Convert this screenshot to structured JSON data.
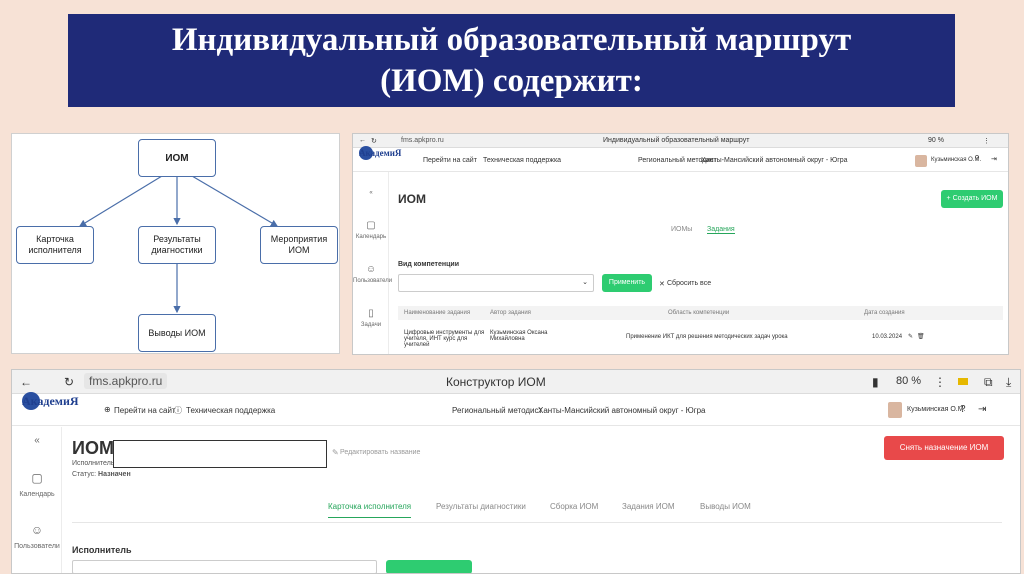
{
  "title": "Индивидуальный образовательный маршрут (ИОМ) содержит:",
  "diagram": {
    "root": "ИОМ",
    "nodes": [
      "Карточка исполнителя",
      "Результаты диагностики",
      "Мероприятия ИОМ"
    ],
    "bottom": "Выводы ИОМ"
  },
  "shot1": {
    "url": "fms.apkpro.ru",
    "window_title": "Индивидуальный образовательный маршрут",
    "zoom": "90 %",
    "logo": "АкадемиЯ",
    "go_site": "Перейти на сайт",
    "support": "Техническая поддержка",
    "role": "Региональный методист",
    "region": "Ханты-Мансийский автономный округ - Югра",
    "user": "Кузьминская О.М.",
    "heading": "ИОМ",
    "create_btn": "+ Создать ИОМ",
    "tabs": [
      "ИОМы",
      "Задания"
    ],
    "filter_label": "Вид компетенции",
    "apply_btn": "Применить",
    "reset": "Сбросить все",
    "columns": [
      "Наименование задания",
      "Автор задания",
      "Область компетенции",
      "Дата создания"
    ],
    "row": [
      "Цифровые инструменты для учителя, ИНТ курс для учителей",
      "Кузьминская Оксана Михайловна",
      "Применение ИКТ для решения методических задач урока",
      "10.03.2024"
    ],
    "side": [
      "Календарь",
      "Пользователи",
      "Задачи"
    ]
  },
  "shot2": {
    "url": "fms.apkpro.ru",
    "window_title": "Конструктор ИОМ",
    "zoom": "80 %",
    "logo": "АкадемиЯ",
    "go_site": "Перейти на сайт",
    "support": "Техническая поддержка",
    "role": "Региональный методист",
    "region": "Ханты-Мансийский автономный округ - Югра",
    "user": "Кузьминская О.М.",
    "heading": "ИОМ:",
    "edit_link": "Редактировать название",
    "executor_label": "Исполнитель",
    "status_label": "Статус:",
    "status_value": "Назначен",
    "remove_btn": "Снять назначение ИОМ",
    "tabs": [
      "Карточка исполнителя",
      "Результаты диагностики",
      "Сборка ИОМ",
      "Задания ИОМ",
      "Выводы ИОМ"
    ],
    "section": "Исполнитель",
    "side": [
      "Календарь",
      "Пользователи"
    ]
  },
  "colors": {
    "banner": "#1f2a78",
    "accent_green": "#2ecc71",
    "accent_red": "#e8494a",
    "background": "#f7e2d6"
  }
}
